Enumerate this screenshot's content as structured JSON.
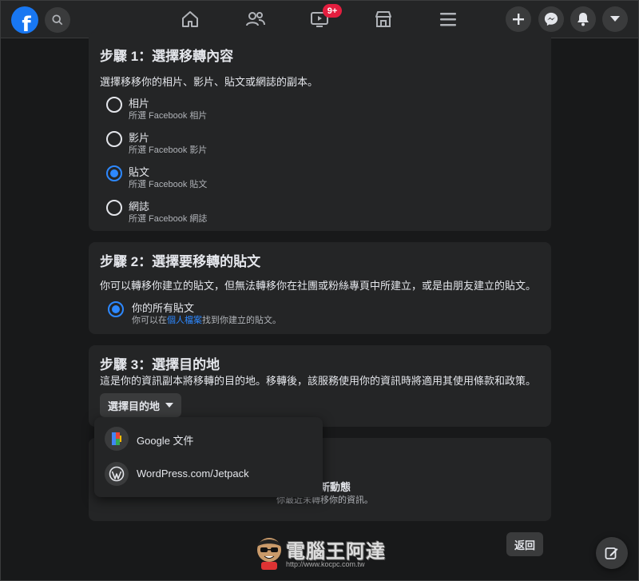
{
  "topbar": {
    "logo_letter": "f",
    "notification_badge": "9+"
  },
  "step1": {
    "title": "步驟 1：選擇移轉內容",
    "description": "選擇移移你的相片、影片、貼文或網誌的副本。",
    "options": [
      {
        "label": "相片",
        "sub": "所選 Facebook 相片",
        "checked": false
      },
      {
        "label": "影片",
        "sub": "所選 Facebook 影片",
        "checked": false
      },
      {
        "label": "貼文",
        "sub": "所選 Facebook 貼文",
        "checked": true
      },
      {
        "label": "網誌",
        "sub": "所選 Facebook 網誌",
        "checked": false
      }
    ]
  },
  "step2": {
    "title": "步驟 2：選擇要移轉的貼文",
    "description": "你可以轉移你建立的貼文，但無法轉移你在社團或粉絲專頁中所建立，或是由朋友建立的貼文。",
    "option_label": "你的所有貼文",
    "option_sub_prefix": "你可以在",
    "option_sub_link": "個人檔案",
    "option_sub_suffix": "找到你建立的貼文。"
  },
  "step3": {
    "title": "步驟 3：選擇目的地",
    "description": "這是你的資訊副本將移轉的目的地。移轉後，該服務使用你的資訊時將適用其使用條款和政策。",
    "select_label": "選擇目的地"
  },
  "dropdown": {
    "items": [
      {
        "label": "Google 文件",
        "icon": "google-docs-icon"
      },
      {
        "label": "WordPress.com/Jetpack",
        "icon": "wordpress-icon"
      }
    ]
  },
  "step4_partial": {
    "title_fragment": "新動態",
    "sub_fragment": "你最近未轉移你的資訊。"
  },
  "footer": {
    "back_label": "返回"
  },
  "watermark": {
    "text": "電腦王阿達",
    "url": "http://www.kocpc.com.tw"
  },
  "colors": {
    "accent": "#2d88ff",
    "brand": "#1877f2",
    "badge": "#e41e3f",
    "card": "#242526",
    "background": "#18191a"
  }
}
